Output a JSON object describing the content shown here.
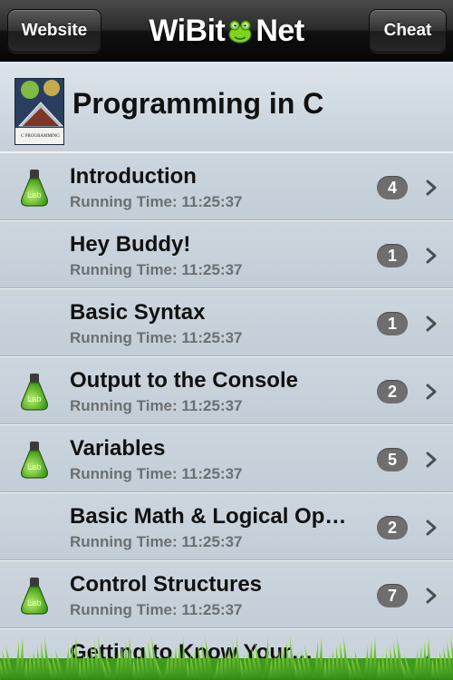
{
  "navbar": {
    "left_button": "Website",
    "right_button": "Cheat",
    "logo_left": "WiBit",
    "logo_right": "Net"
  },
  "course": {
    "title": "Programming in C",
    "cover_text": "C PROGRAMMING"
  },
  "lessons": [
    {
      "title": "Introduction",
      "subtitle": "Running Time: 11:25:37",
      "count": "4",
      "has_lab": true
    },
    {
      "title": "Hey Buddy!",
      "subtitle": "Running Time: 11:25:37",
      "count": "1",
      "has_lab": false
    },
    {
      "title": "Basic Syntax",
      "subtitle": "Running Time: 11:25:37",
      "count": "1",
      "has_lab": false
    },
    {
      "title": "Output to the Console",
      "subtitle": "Running Time: 11:25:37",
      "count": "2",
      "has_lab": true
    },
    {
      "title": "Variables",
      "subtitle": "Running Time: 11:25:37",
      "count": "5",
      "has_lab": true
    },
    {
      "title": "Basic Math & Logical Op…",
      "subtitle": "Running Time: 11:25:37",
      "count": "2",
      "has_lab": false
    },
    {
      "title": "Control Structures",
      "subtitle": "Running Time: 11:25:37",
      "count": "7",
      "has_lab": true
    },
    {
      "title": "Getting to Know Your…",
      "subtitle": "",
      "count": "",
      "has_lab": false
    }
  ],
  "lab_label": "Lab",
  "colors": {
    "navbar": "#1a1a1a",
    "badge": "#6e6e6e",
    "list_bg": "#c9d3dd",
    "grass": "#4caf2a",
    "frog": "#7ed321"
  },
  "icons": {
    "row_icon": "lab-flask-icon",
    "chevron": "chevron-right-icon",
    "logo": "frog-logo-icon"
  }
}
